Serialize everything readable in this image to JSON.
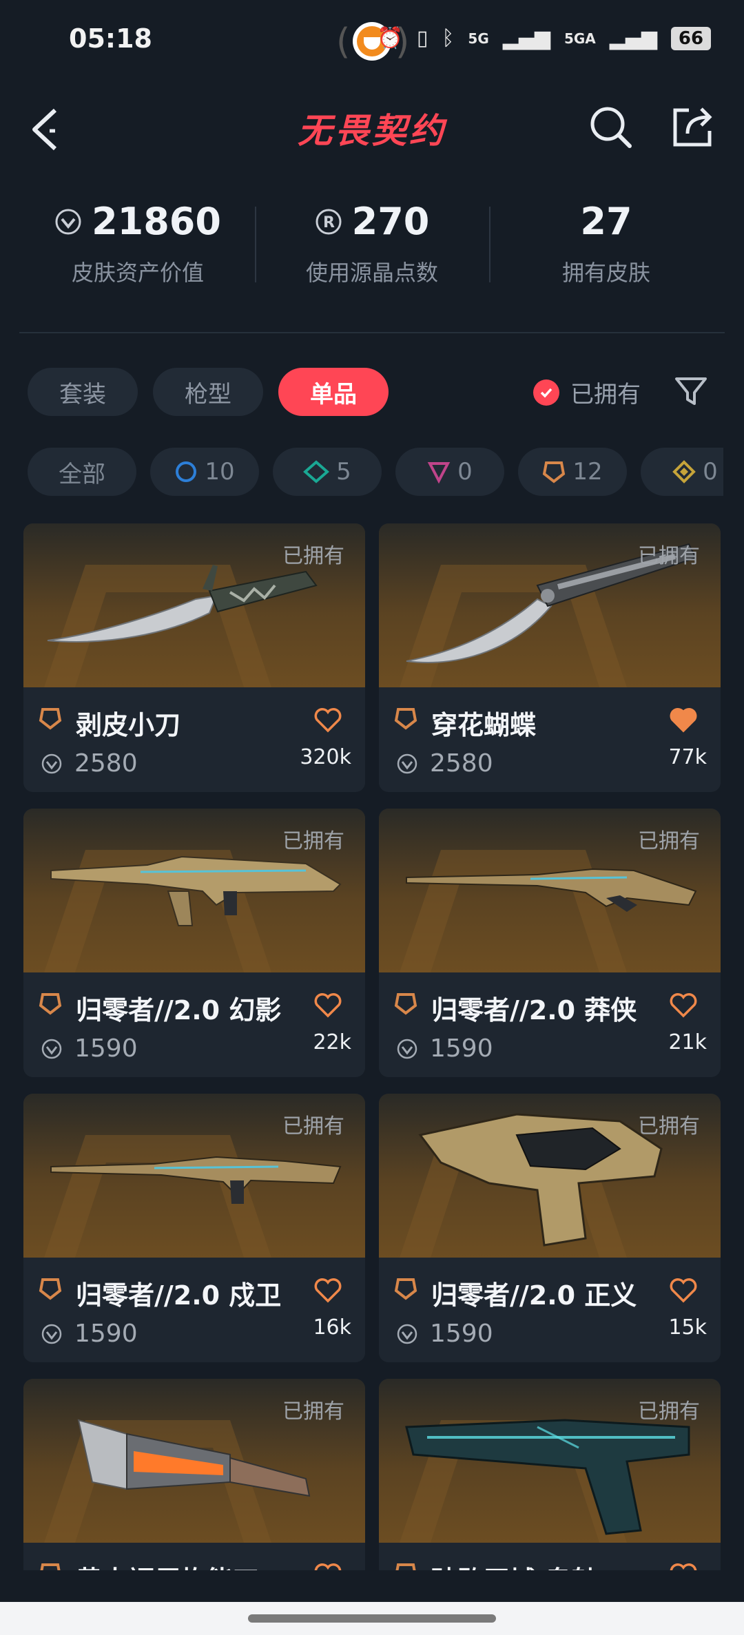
{
  "status": {
    "time": "05:18",
    "battery": "66",
    "signal1": "5G",
    "signal2": "5GA"
  },
  "header": {
    "title": "无畏契约"
  },
  "stats": [
    {
      "value": "21860",
      "label": "皮肤资产价值",
      "icon": "vp-icon"
    },
    {
      "value": "270",
      "label": "使用源晶点数",
      "icon": "radianite-icon"
    },
    {
      "value": "27",
      "label": "拥有皮肤",
      "icon": ""
    }
  ],
  "tabs": [
    {
      "label": "套装",
      "active": false
    },
    {
      "label": "枪型",
      "active": false
    },
    {
      "label": "单品",
      "active": true
    }
  ],
  "owned_filter": {
    "label": "已拥有",
    "checked": true
  },
  "chips": [
    {
      "label": "全部",
      "count": "",
      "color": ""
    },
    {
      "label": "",
      "count": "10",
      "color": "#2d7fd8"
    },
    {
      "label": "",
      "count": "5",
      "color": "#1aa894"
    },
    {
      "label": "",
      "count": "0",
      "color": "#c0448a"
    },
    {
      "label": "",
      "count": "12",
      "color": "#d8874a"
    },
    {
      "label": "",
      "count": "0",
      "color": "#c6a43a"
    }
  ],
  "cards": [
    {
      "name": "剥皮小刀",
      "price": "2580",
      "likes": "320k",
      "owned": "已拥有",
      "liked": false
    },
    {
      "name": "穿花蝴蝶",
      "price": "2580",
      "likes": "77k",
      "owned": "已拥有",
      "liked": true
    },
    {
      "name": "归零者//2.0 幻影",
      "price": "1590",
      "likes": "22k",
      "owned": "已拥有",
      "liked": false
    },
    {
      "name": "归零者//2.0 莽侠",
      "price": "1590",
      "likes": "21k",
      "owned": "已拥有",
      "liked": false
    },
    {
      "name": "归零者//2.0 戍卫",
      "price": "1590",
      "likes": "16k",
      "owned": "已拥有",
      "liked": false
    },
    {
      "name": "归零者//2.0 正义",
      "price": "1590",
      "likes": "15k",
      "owned": "已拥有",
      "liked": false
    },
    {
      "name": "黄大福巨炸能刀",
      "price": "",
      "likes": "",
      "owned": "已拥有",
      "liked": false
    },
    {
      "name": "破败王城 鬼魅",
      "price": "",
      "likes": "",
      "owned": "已拥有",
      "liked": false
    }
  ],
  "colors": {
    "accent": "#ff4655",
    "heart": "#f0884a",
    "tier": "#d8874a"
  }
}
